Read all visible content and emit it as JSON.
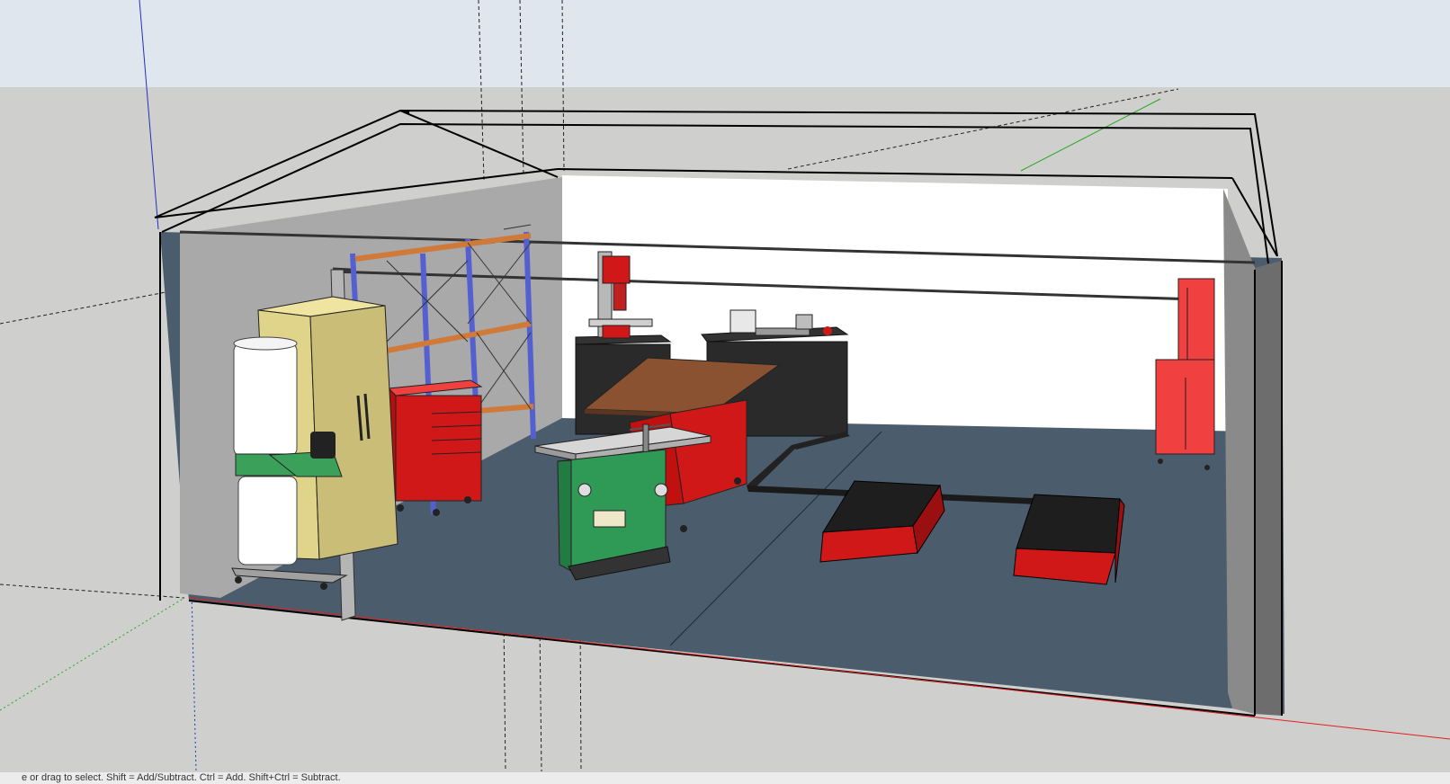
{
  "app": {
    "name": "SketchUp",
    "viewport_label": "3D model viewport"
  },
  "scene": {
    "subject": "garage workshop model",
    "colors": {
      "sky": "#dfe6ee",
      "ground": "#cfcfcd",
      "floor": "#4b5d6c",
      "wall_back": "#ffffff",
      "wall_left": "#a9a9a9",
      "wall_right": "#7d7d7d",
      "red_axis": "#e02020",
      "green_axis": "#22aa22",
      "blue_axis": "#2030c0",
      "tool_red": "#d01818",
      "saw_green": "#2f9a55",
      "shelf_blue": "#5560d0",
      "beam_orange": "#d07a3a",
      "cabinet_yellow": "#e0d48a",
      "bench_top": "#8a5230"
    }
  },
  "status": {
    "text": "e or drag to select. Shift = Add/Subtract. Ctrl = Add. Shift+Ctrl = Subtract."
  }
}
